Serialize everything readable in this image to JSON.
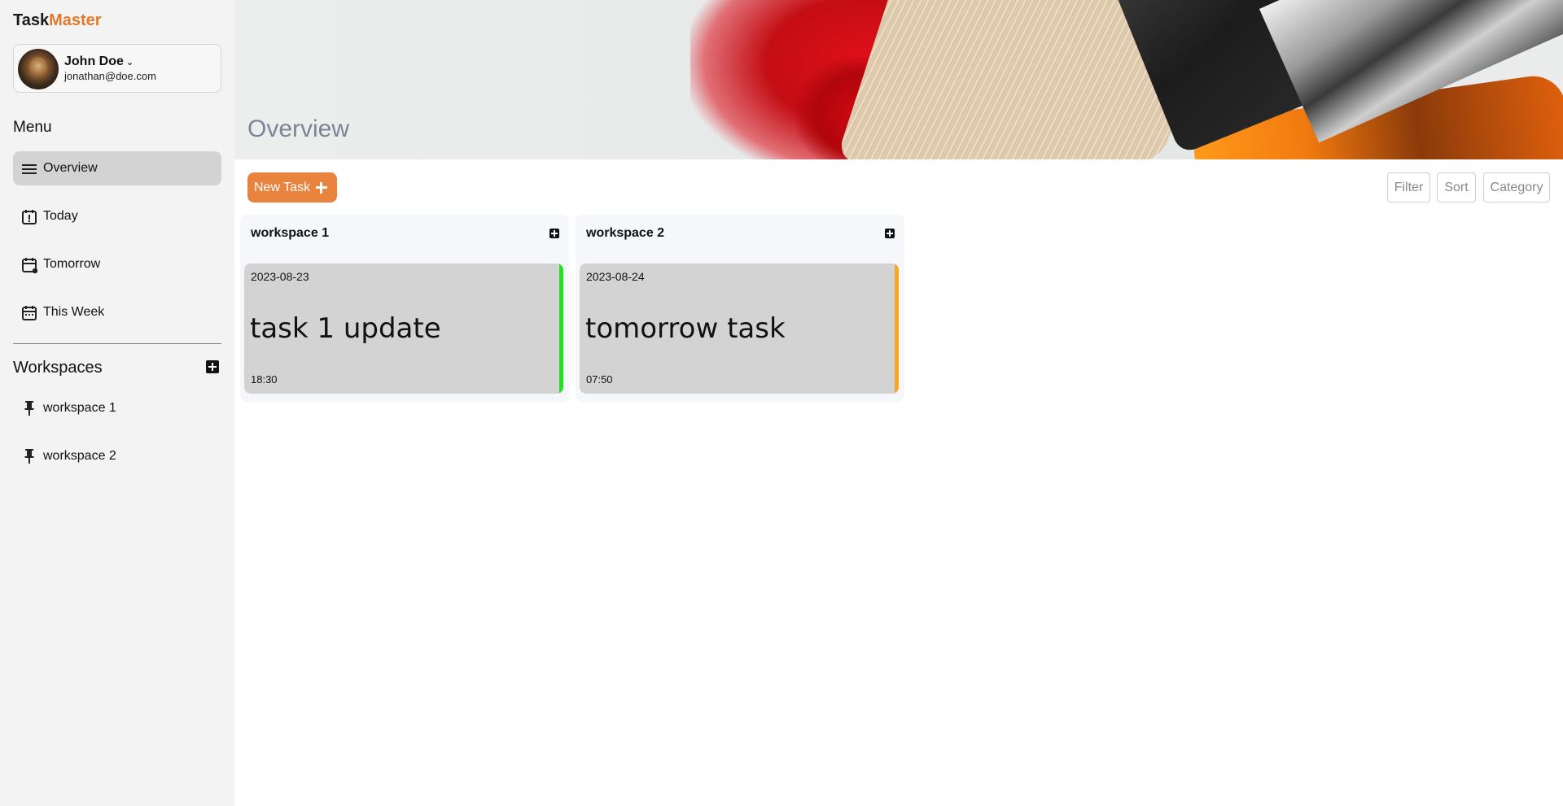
{
  "app": {
    "brand_part1": "Task",
    "brand_part2": "Master"
  },
  "user": {
    "name": "John Doe",
    "email": "jonathan@doe.com"
  },
  "menu": {
    "title": "Menu",
    "items": [
      {
        "label": "Overview",
        "icon": "menu-lines-icon",
        "active": true
      },
      {
        "label": "Today",
        "icon": "calendar-alert-icon"
      },
      {
        "label": "Tomorrow",
        "icon": "calendar-next-icon"
      },
      {
        "label": "This Week",
        "icon": "calendar-week-icon"
      }
    ]
  },
  "workspaces": {
    "title": "Workspaces",
    "items": [
      {
        "label": "workspace 1",
        "icon": "pin-icon"
      },
      {
        "label": "workspace 2",
        "icon": "pin-icon"
      }
    ]
  },
  "header": {
    "title": "Overview"
  },
  "toolbar": {
    "new_task_label": "New Task",
    "filter_label": "Filter",
    "sort_label": "Sort",
    "category_label": "Category"
  },
  "board": {
    "columns": [
      {
        "title": "workspace 1",
        "tasks": [
          {
            "date": "2023-08-23",
            "title": "task 1 update",
            "time": "18:30",
            "status_color": "#22e022"
          }
        ]
      },
      {
        "title": "workspace 2",
        "tasks": [
          {
            "date": "2023-08-24",
            "title": "tomorrow task",
            "time": "07:50",
            "status_color": "#f5a623"
          }
        ]
      }
    ]
  },
  "colors": {
    "accent": "#e07b2e",
    "button": "#e8843e"
  }
}
